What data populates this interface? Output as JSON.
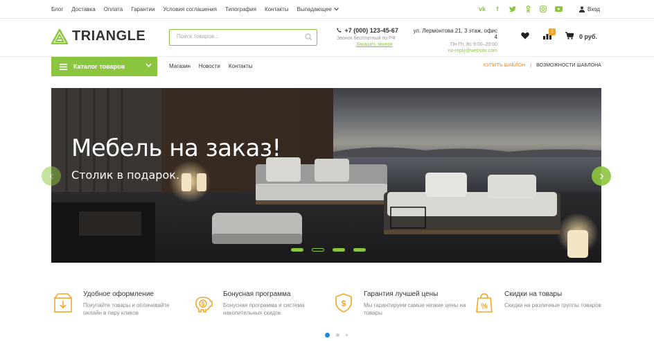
{
  "topbar": {
    "links": [
      "Блог",
      "Доставка",
      "Оплата",
      "Гарантии",
      "Условия соглашения",
      "Типография",
      "Контакты"
    ],
    "dropdown_label": "Выпадающее",
    "login_label": "Вход"
  },
  "header": {
    "logo_text": "TRIANGLE",
    "search_placeholder": "Поиск товаров...",
    "phone": "+7 (000) 123-45-67",
    "phone_note": "Звонок бесплатный по РФ",
    "callback_label": "Заказать звонок",
    "address": "ул. Лермонтова 21, 3 этаж, офис 4",
    "hours": "Пн-Пт, Вс 9:00–20:00",
    "email": "no-reply@website.com",
    "compare_count": "1",
    "cart_total": "0 руб."
  },
  "nav": {
    "catalog_label": "Каталог товаров",
    "links": [
      "Магазин",
      "Новости",
      "Контакты"
    ],
    "buy_template": "КУПИТЬ ШАБЛОН",
    "separator": "|",
    "template_features": "ВОЗМОЖНОСТИ ШАБЛОНА"
  },
  "slider": {
    "title": "Мебель на заказ!",
    "subtitle": "Столик в подарок.",
    "slide_count": 4,
    "active_slide": 2
  },
  "features": [
    {
      "title": "Удобное оформление",
      "desc": "Покупайте товары и оплачивайте онлайн в пару кликов",
      "icon": "box-icon"
    },
    {
      "title": "Бонусная программа",
      "desc": "Бонусная программа и система накопительных скидок",
      "icon": "piggy-bank-icon"
    },
    {
      "title": "Гарантия лучшей цены",
      "desc": "Мы гарантируем самые низкие цены на товары",
      "icon": "shield-dollar-icon"
    },
    {
      "title": "Скидки на товары",
      "desc": "Скидки на различные группы товаров",
      "icon": "discount-bag-icon"
    }
  ],
  "colors": {
    "accent": "#8cc63f",
    "orange": "#f08a24",
    "pager_active": "#1e88e5"
  }
}
